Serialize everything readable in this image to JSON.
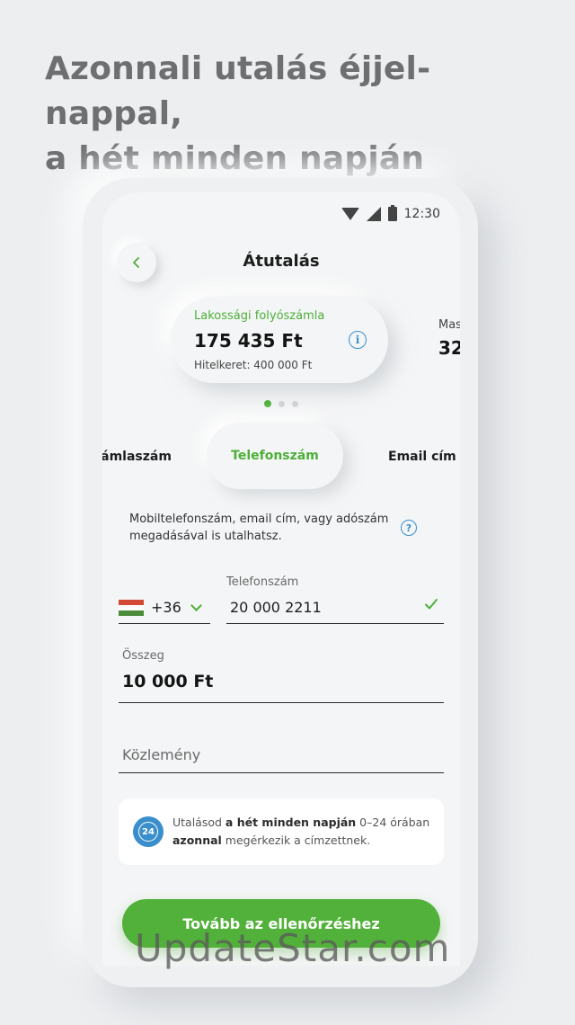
{
  "headline": {
    "line1": "Azonnali utalás éjjel-nappal,",
    "line2": "a hét minden napján"
  },
  "statusbar": {
    "time": "12:30"
  },
  "header": {
    "title": "Átutalás"
  },
  "account": {
    "name": "Lakossági folyószámla",
    "balance": "175 435 Ft",
    "credit": "Hitelkeret: 400 000 Ft"
  },
  "next_account": {
    "name_partial": "Mas",
    "balance_partial": "32"
  },
  "tabs": {
    "left": "zámlaszám",
    "active": "Telefonszám",
    "right": "Email cím"
  },
  "hint": "Mobiltelefonszám, email cím, vagy adószám megadásával is utalhatsz.",
  "country_code": "+36",
  "phone": {
    "label": "Telefonszám",
    "value": "20 000 2211"
  },
  "amount": {
    "label": "Összeg",
    "value": "10 000 Ft"
  },
  "memo": {
    "placeholder": "Közlemény"
  },
  "notice": {
    "t1": "Utalásod ",
    "b1": "a hét minden napján",
    "t2": " 0–24 órában ",
    "b2": "azonnal",
    "t3": " megérkezik a címzettnek.",
    "icon_label": "24"
  },
  "cta": "Tovább az ellenőrzéshez",
  "watermark": "UpdateStar.com",
  "colors": {
    "accent": "#4caf37",
    "info": "#3a8ecb",
    "background": "#eceef0"
  }
}
